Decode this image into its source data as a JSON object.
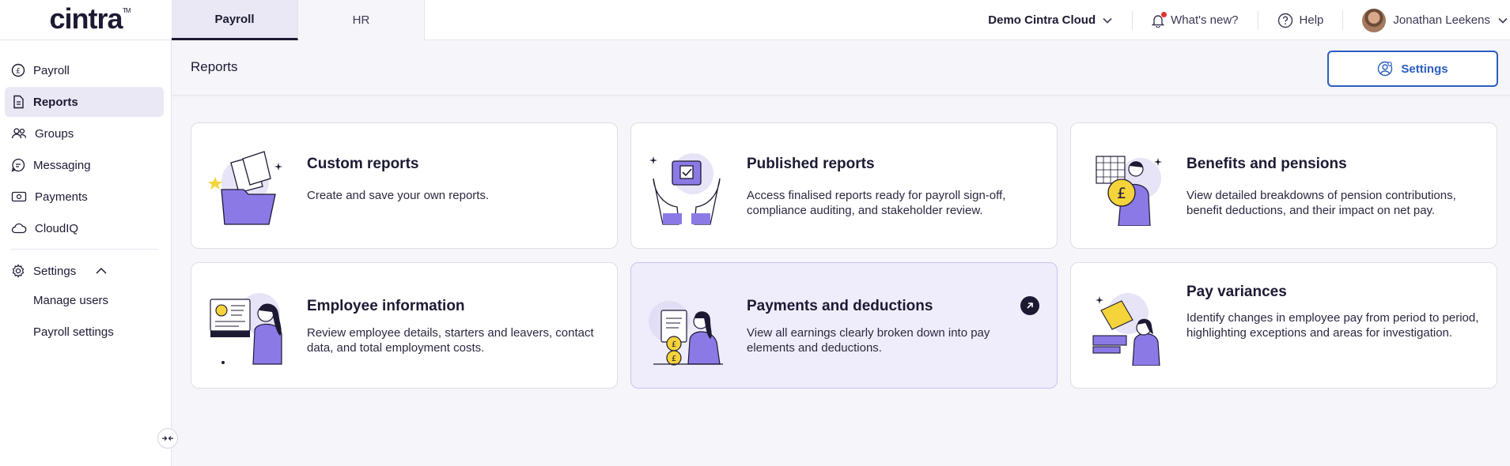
{
  "brand": {
    "logo_text": "cintra",
    "trademark": "TM"
  },
  "product_tabs": [
    {
      "label": "Payroll",
      "active": true
    },
    {
      "label": "HR",
      "active": false
    }
  ],
  "topbar": {
    "organisation": "Demo Cintra Cloud",
    "whats_new": "What's new?",
    "help": "Help",
    "user_name": "Jonathan Leekens"
  },
  "sidebar": {
    "items": [
      {
        "label": "Payroll",
        "icon": "payroll-coin-icon"
      },
      {
        "label": "Reports",
        "icon": "reports-icon",
        "active": true
      },
      {
        "label": "Groups",
        "icon": "groups-icon"
      },
      {
        "label": "Messaging",
        "icon": "messaging-icon"
      },
      {
        "label": "Payments",
        "icon": "payments-icon"
      },
      {
        "label": "CloudIQ",
        "icon": "cloud-icon"
      }
    ],
    "settings": {
      "label": "Settings",
      "expanded": true,
      "children": [
        {
          "label": "Manage users"
        },
        {
          "label": "Payroll settings"
        }
      ]
    }
  },
  "page": {
    "title": "Reports",
    "settings_button": "Settings"
  },
  "cards": [
    {
      "title": "Custom reports",
      "description": "Create and save your own reports."
    },
    {
      "title": "Published reports",
      "description": "Access finalised reports ready for payroll sign-off, compliance auditing, and stakeholder review."
    },
    {
      "title": "Benefits and pensions",
      "description": "View detailed breakdowns of pension contributions, benefit deductions, and their impact on net pay."
    },
    {
      "title": "Employee information",
      "description": "Review employee details, starters and leavers, contact data, and total employment costs."
    },
    {
      "title": "Payments and deductions",
      "description": "View all earnings clearly broken down into pay elements and deductions.",
      "highlighted": true
    },
    {
      "title": "Pay variances",
      "description": "Identify changes in employee pay from period to period, highlighting exceptions and areas for investigation."
    }
  ],
  "colors": {
    "accent": "#2a5dbf",
    "ink": "#1c1a33",
    "illustration_purple": "#8b7ae6",
    "illustration_yellow": "#f5d33a",
    "active_bg": "#e9e8f4",
    "highlight_card_bg": "#efedfb"
  }
}
